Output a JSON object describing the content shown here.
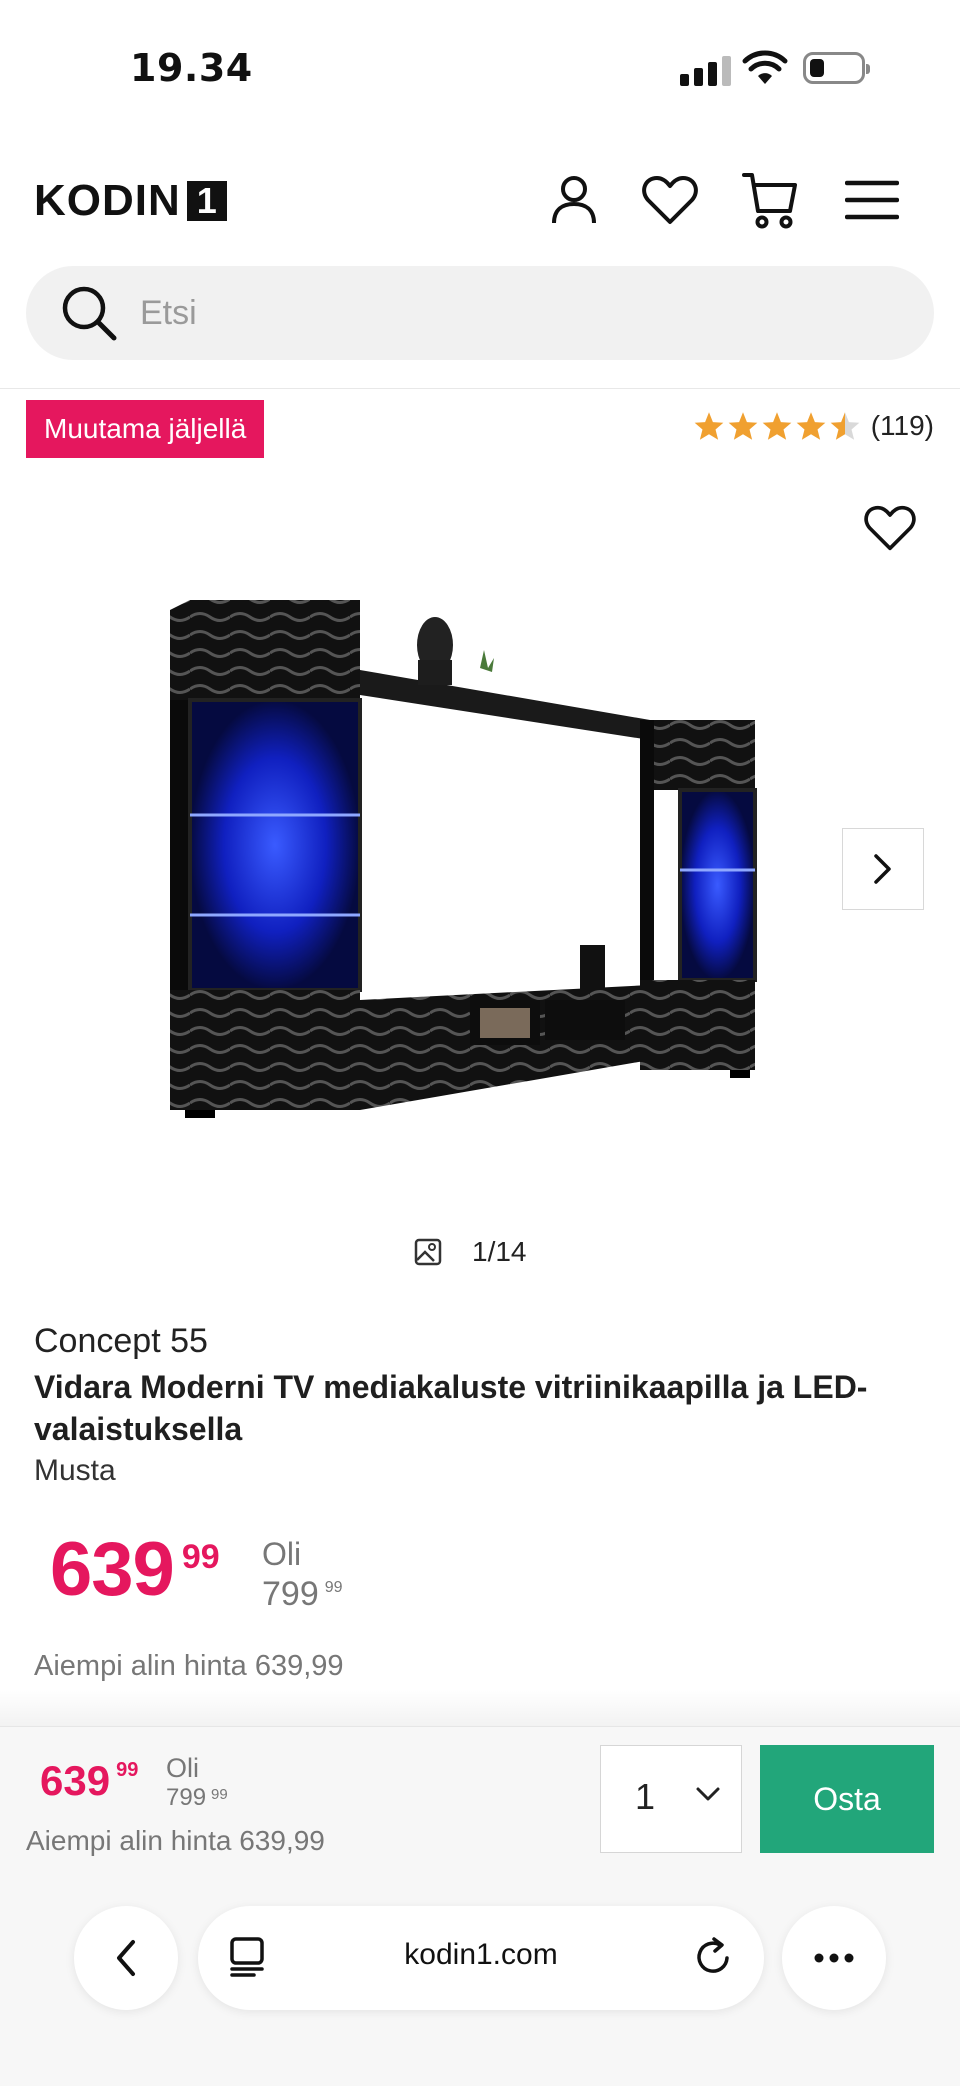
{
  "status_bar": {
    "time": "19.34"
  },
  "header": {
    "logo_text": "KODIN",
    "logo_number": "1"
  },
  "search": {
    "placeholder": "Etsi"
  },
  "badge": {
    "label": "Muutama jäljellä"
  },
  "rating": {
    "stars": 4.5,
    "max": 5,
    "count_text": "(119)",
    "star_color": "#f0a030"
  },
  "gallery": {
    "counter": "1/14"
  },
  "product": {
    "brand": "Concept 55",
    "title": "Vidara Moderni TV mediakaluste vitriinikaapilla ja LED-valaistuksella",
    "variant": "Musta",
    "price_int": "639",
    "price_dec": "99",
    "was_label": "Oli",
    "was_int": "799",
    "was_dec": "99",
    "lowest_price": "Aiempi alin hinta 639,99"
  },
  "sticky_bar": {
    "price_int": "639",
    "price_dec": "99",
    "was_label": "Oli",
    "was_int": "799",
    "was_dec": "99",
    "lowest_price": "Aiempi alin hinta 639,99",
    "quantity": "1",
    "buy_label": "Osta"
  },
  "browser": {
    "url": "kodin1.com"
  },
  "colors": {
    "accent": "#e5175e",
    "buy": "#22a67a"
  }
}
